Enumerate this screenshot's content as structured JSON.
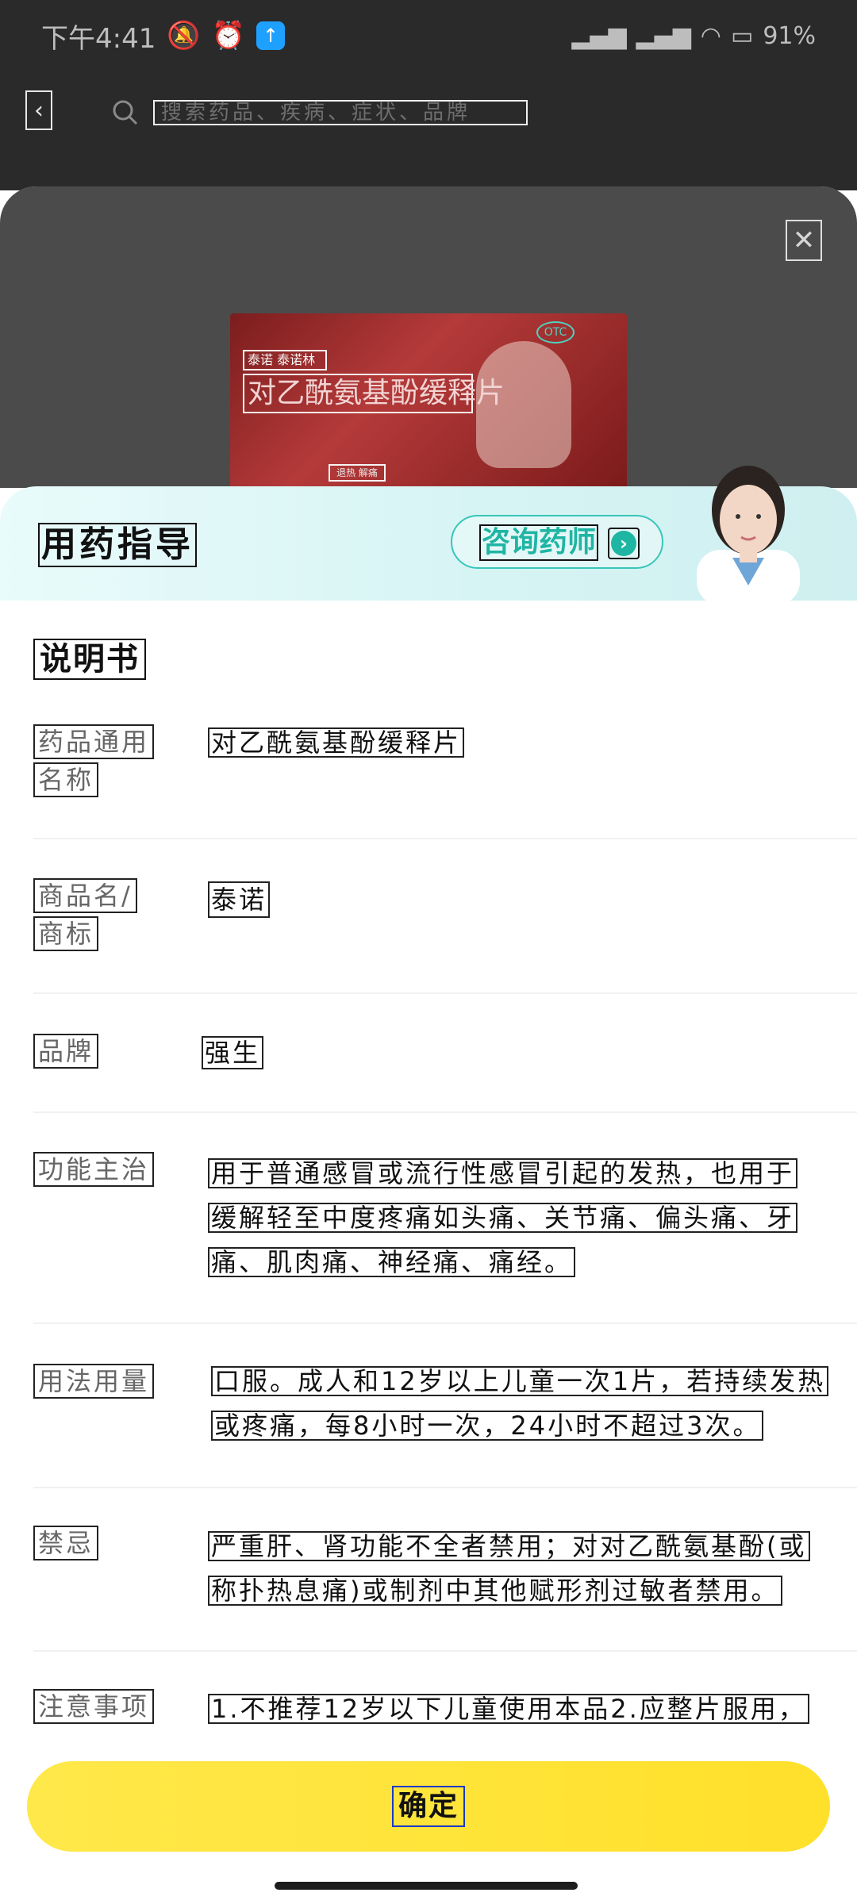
{
  "status_bar": {
    "time": "下午4:41",
    "battery": "91"
  },
  "search": {
    "placeholder": "搜索药品、疾病、症状、品牌"
  },
  "product_image": {
    "brand_text": "泰诺 泰诺林",
    "name_text": "对乙酰氨基酚缓释片",
    "sub_text": "退热 解痛",
    "otc_badge": "OTC"
  },
  "guide": {
    "title": "用药指导",
    "consult_label": "咨询药师"
  },
  "manual": {
    "title": "说明书",
    "rows": [
      {
        "label_lines": [
          "药品通用",
          "名称"
        ],
        "value_lines": [
          "对乙酰氨基酚缓释片"
        ]
      },
      {
        "label_lines": [
          "商品名/",
          "商标"
        ],
        "value_lines": [
          "泰诺"
        ]
      },
      {
        "label_lines": [
          "品牌"
        ],
        "value_lines": [
          "强生"
        ]
      },
      {
        "label_lines": [
          "功能主治"
        ],
        "value_lines": [
          "用于普通感冒或流行性感冒引起的发热，也用于",
          "缓解轻至中度疼痛如头痛、关节痛、偏头痛、牙",
          "痛、肌肉痛、神经痛、痛经。"
        ]
      },
      {
        "label_lines": [
          "用法用量"
        ],
        "value_lines": [
          "口服。成人和12岁以上儿童一次1片，若持续发热",
          "或疼痛，每8小时一次，24小时不超过3次。"
        ]
      },
      {
        "label_lines": [
          "禁忌"
        ],
        "value_lines": [
          "严重肝、肾功能不全者禁用；对对乙酰氨基酚(或",
          "称扑热息痛)或制剂中其他赋形剂过敏者禁用。"
        ]
      },
      {
        "label_lines": [
          "注意事项"
        ],
        "value_lines": [
          "1.不推荐12岁以下儿童使用本品2.应整片服用，"
        ]
      }
    ]
  },
  "footer": {
    "confirm_label": "确定"
  },
  "colors": {
    "accent_teal": "#1fb5a3",
    "confirm_yellow": "#ffe33a"
  }
}
